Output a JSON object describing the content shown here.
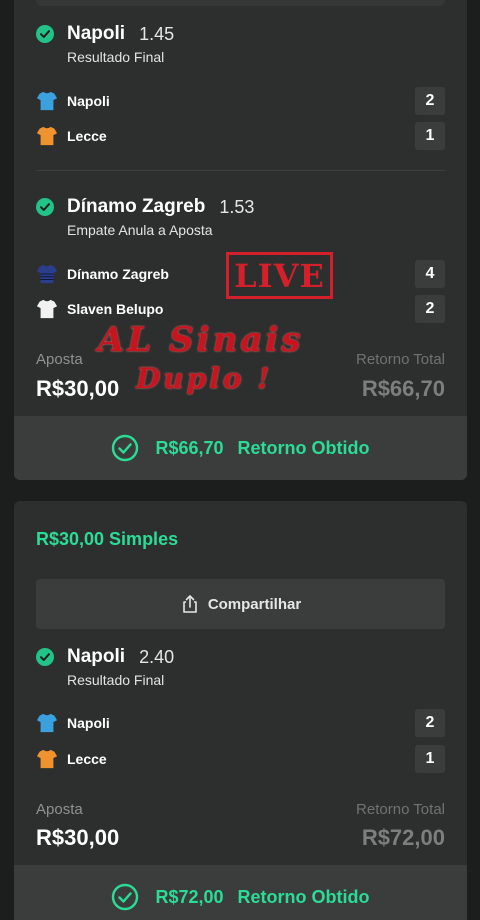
{
  "bet1": {
    "selections": [
      {
        "team": "Napoli",
        "odds": "1.45",
        "market": "Resultado Final",
        "rows": [
          {
            "name": "Napoli",
            "score": "2",
            "shirt_color": "#3aa0de"
          },
          {
            "name": "Lecce",
            "score": "1",
            "shirt_color": "#f0922e"
          }
        ]
      },
      {
        "team": "Dínamo Zagreb",
        "odds": "1.53",
        "market": "Empate Anula a Aposta",
        "rows": [
          {
            "name": "Dínamo Zagreb",
            "score": "4",
            "shirt_color": "#2a3f8c"
          },
          {
            "name": "Slaven Belupo",
            "score": "2",
            "shirt_color": "#f2f2f2"
          }
        ]
      }
    ],
    "stake_label": "Aposta",
    "stake_value": "R$30,00",
    "return_label": "Retorno Total",
    "return_value": "R$66,70",
    "result_amount": "R$66,70",
    "result_text": "Retorno Obtido"
  },
  "bet2": {
    "title": "R$30,00 Simples",
    "share_label": "Compartilhar",
    "selection": {
      "team": "Napoli",
      "odds": "2.40",
      "market": "Resultado Final",
      "rows": [
        {
          "name": "Napoli",
          "score": "2",
          "shirt_color": "#3aa0de"
        },
        {
          "name": "Lecce",
          "score": "1",
          "shirt_color": "#f0922e"
        }
      ]
    },
    "stake_label": "Aposta",
    "stake_value": "R$30,00",
    "return_label": "Retorno Total",
    "return_value": "R$72,00",
    "result_amount": "R$72,00",
    "result_text": "Retorno Obtido"
  },
  "overlay": {
    "live": "LIVE",
    "promo_line1": "AL Sinais",
    "promo_line2": "Duplo !"
  },
  "colors": {
    "accent_green": "#2bdc96",
    "check_green": "#22c389",
    "overlay_red": "#d4202a"
  }
}
